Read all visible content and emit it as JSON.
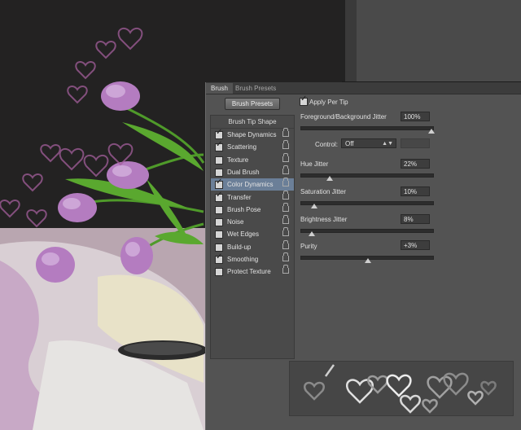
{
  "tabs": {
    "active": "Brush",
    "inactive": "Brush Presets"
  },
  "brush_presets_button": "Brush Presets",
  "apply_per_tip": {
    "label": "Apply Per Tip",
    "checked": true
  },
  "list_header": "Brush Tip Shape",
  "options": [
    {
      "label": "Shape Dynamics",
      "checked": true,
      "selected": false
    },
    {
      "label": "Scattering",
      "checked": true,
      "selected": false
    },
    {
      "label": "Texture",
      "checked": false,
      "selected": false
    },
    {
      "label": "Dual Brush",
      "checked": false,
      "selected": false
    },
    {
      "label": "Color Dynamics",
      "checked": true,
      "selected": true
    },
    {
      "label": "Transfer",
      "checked": true,
      "selected": false
    },
    {
      "label": "Brush Pose",
      "checked": false,
      "selected": false
    },
    {
      "label": "Noise",
      "checked": false,
      "selected": false
    },
    {
      "label": "Wet Edges",
      "checked": false,
      "selected": false
    },
    {
      "label": "Build-up",
      "checked": false,
      "selected": false
    },
    {
      "label": "Smoothing",
      "checked": true,
      "selected": false
    },
    {
      "label": "Protect Texture",
      "checked": false,
      "selected": false
    }
  ],
  "settings": {
    "fg_bg": {
      "label": "Foreground/Background Jitter",
      "value": "100%",
      "level": 1.0
    },
    "control": {
      "label": "Control:",
      "value": "Off"
    },
    "hue": {
      "label": "Hue Jitter",
      "value": "22%",
      "level": 0.22
    },
    "saturation": {
      "label": "Saturation Jitter",
      "value": "10%",
      "level": 0.1
    },
    "brightness": {
      "label": "Brightness Jitter",
      "value": "8%",
      "level": 0.08
    },
    "purity": {
      "label": "Purity",
      "value": "+3%",
      "level": 0.515
    }
  },
  "colors": {
    "panel": "#535353",
    "selected_row": "#6b7f98",
    "tulip": "#b47cc0",
    "leaf": "#4f9a2a"
  }
}
